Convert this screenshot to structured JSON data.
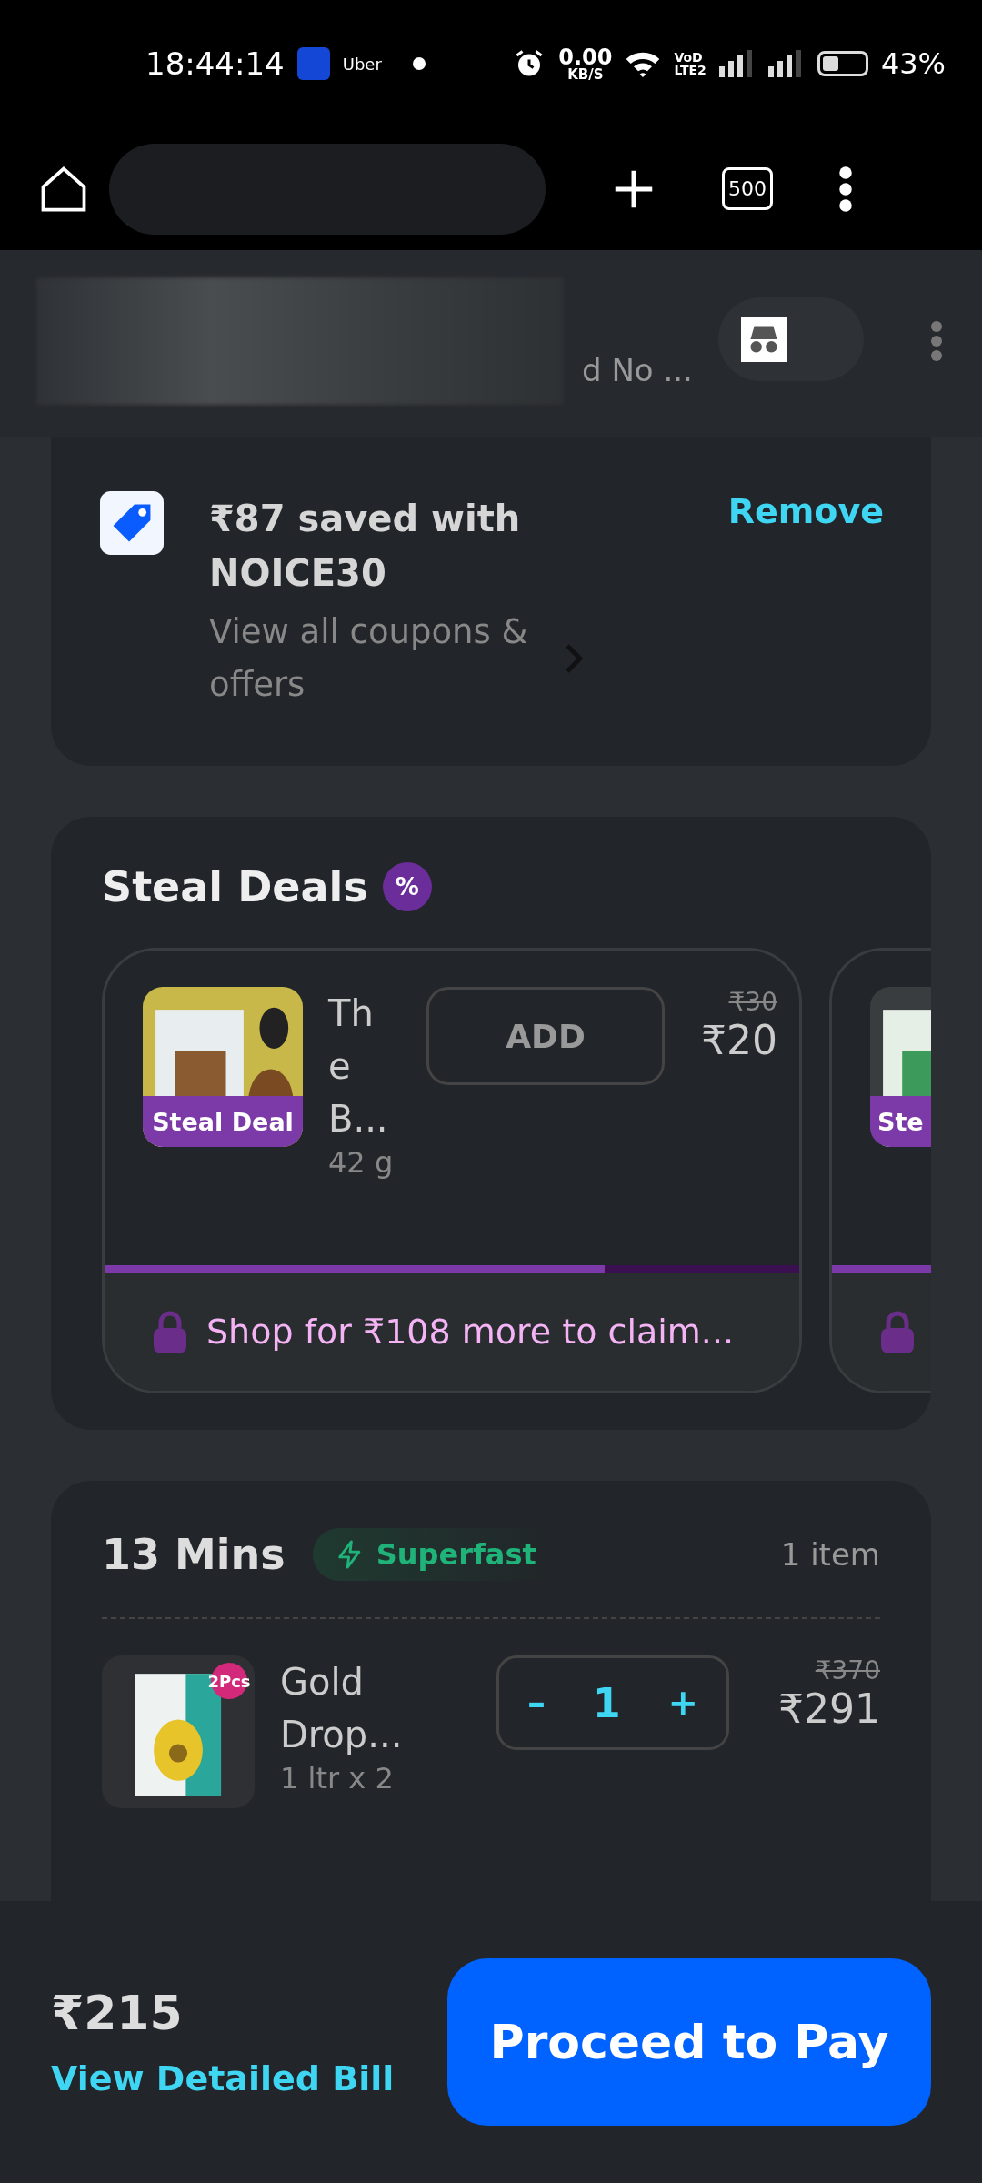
{
  "status_bar": {
    "time": "18:44:14",
    "notification_label": "Uber",
    "speed_value": "0.00",
    "speed_unit": "KB/S",
    "network_top": "VoD",
    "network_bottom": "LTE2",
    "battery": "43%"
  },
  "browser": {
    "tab_count": "500",
    "page_subtitle": "d No ..."
  },
  "coupon": {
    "title": "₹87 saved with NOICE30",
    "link": "View all coupons & offers",
    "action": "Remove"
  },
  "steal_deals": {
    "title": "Steal Deals",
    "badge": "%",
    "deals": [
      {
        "name": "Th e B...",
        "weight": "42 g",
        "badge": "Steal Deal",
        "button": "ADD",
        "old_price": "₹30",
        "price": "₹20",
        "level": 0.72,
        "lock_text": "Shop for ₹108 more to claim..."
      },
      {
        "badge": "Ste",
        "level": 1
      }
    ]
  },
  "delivery": {
    "eta": "13 Mins",
    "tag": "Superfast",
    "count": "1 item",
    "items": [
      {
        "name": "Gold Drop...",
        "size": "1 ltr x 2",
        "pack_badge": "2Pcs",
        "quantity": "1",
        "minus": "–",
        "plus": "+",
        "old_price": "₹370",
        "price": "₹291"
      }
    ]
  },
  "footer": {
    "total": "₹215",
    "bill_link": "View Detailed Bill",
    "pay_button": "Proceed to Pay"
  }
}
